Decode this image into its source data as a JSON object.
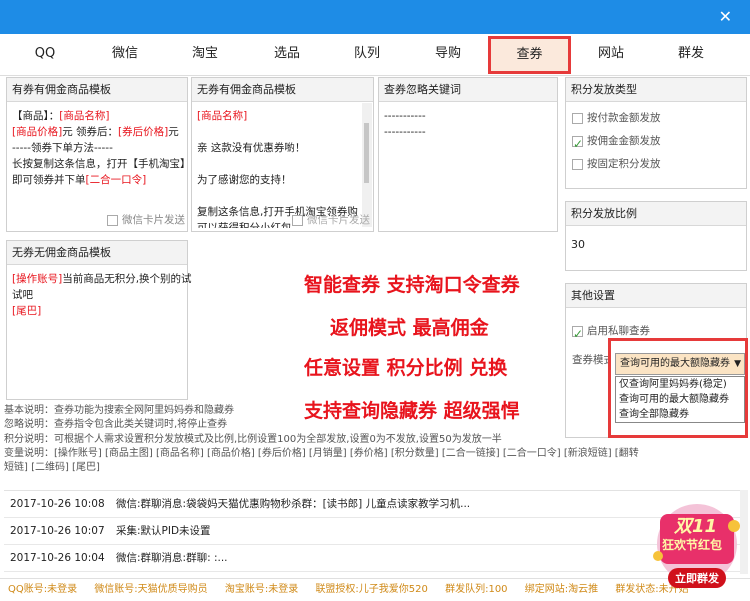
{
  "tabs": [
    "QQ",
    "微信",
    "淘宝",
    "选品",
    "队列",
    "导购",
    "查券",
    "网站",
    "群发"
  ],
  "close_glyph": "✕",
  "panels": {
    "coupon_tpl": {
      "title": "有券有佣金商品模板",
      "lines": [
        [
          "【商品】：",
          "[商品名称]"
        ],
        [
          "[商品价格]",
          "元 领券后：",
          "[券后价格]",
          "元"
        ],
        [
          "-----领券下单方法-----"
        ],
        [
          "长按复制这条信息，打开【手机淘宝】"
        ],
        [
          "即可领券并下单",
          "[二合一口令]"
        ]
      ],
      "wechat_card": "微信卡片发送"
    },
    "no_coupon_tpl": {
      "title": "无券有佣金商品模板",
      "lines": [
        "[商品名称]",
        "",
        "亲 这款没有优惠券喲！",
        "",
        "为了感谢您的支持！",
        "",
        "复制这条信息,打开手机淘宝领券购买",
        "可以获得积分小红包"
      ],
      "wechat_card": "微信卡片发送"
    },
    "keywords": {
      "title": "查券忽略关键词",
      "lines": [
        "-----------",
        "-----------"
      ]
    },
    "no_commission_tpl": {
      "title": "无券无佣金商品模板",
      "lines": [
        [
          "[操作账号]",
          "当前商品无积分,换个别的试"
        ],
        [
          "试吧"
        ],
        [
          "[尾巴]"
        ]
      ]
    },
    "points_type": {
      "title": "积分发放类型",
      "options": [
        {
          "label": "按付款金额发放",
          "checked": false
        },
        {
          "label": "按佣金金额发放",
          "checked": true
        },
        {
          "label": "按固定积分发放",
          "checked": false
        }
      ]
    },
    "points_ratio": {
      "title": "积分发放比例",
      "value": "30"
    },
    "other": {
      "title": "其他设置",
      "private_query": {
        "label": "启用私聊查券",
        "checked": true
      },
      "mode_label": "查券模式"
    }
  },
  "dropdown": {
    "selected": "查询可用的最大额隐藏券",
    "options": [
      "仅查询阿里妈妈券(稳定)",
      "查询可用的最大额隐藏券",
      "查询全部隐藏券"
    ]
  },
  "promo": [
    "智能查券  支持淘口令查券",
    "返佣模式  最高佣金",
    "任意设置  积分比例    兑换",
    "支持查询隐藏券  超级强悍"
  ],
  "help": [
    "基本说明：查券功能为搜索全网阿里妈妈券和隐藏券",
    "忽略说明：查券指令包含此类关键词时,将停止查券",
    "积分说明：可根据个人需求设置积分发放模式及比例,比例设置100为全部发放,设置0为不发放,设置50为发放一半",
    "变量说明：[操作账号]    [商品主图]    [商品名称]    [商品价格]    [券后价格]    [月销量]    [券价格]    [积分数量]    [二合一链接]    [二合一口令]    [新浪短链]    [翻转",
    "短链]    [二维码]    [尾巴]"
  ],
  "log": [
    {
      "time": "2017-10-26 10:08",
      "msg": "微信:群聊消息:袋袋妈天猫优惠购物秒杀群：[读书郎] 儿童点读家教学习机..."
    },
    {
      "time": "2017-10-26 10:07",
      "msg": "采集:默认PID未设置"
    },
    {
      "time": "2017-10-26 10:04",
      "msg": "微信:群聊消息:群聊: :..."
    }
  ],
  "status": [
    "QQ账号:未登录",
    "微信账号:天猫优质导购员",
    "淘宝账号:未登录",
    "联盟授权:儿子我爱你520",
    "群发队列:100",
    "绑定网站:淘云推",
    "群发状态:未开始"
  ],
  "badge": {
    "line1": "双11",
    "line2": "狂欢节红包",
    "button": "立即群发"
  },
  "colors": {
    "accent": "#1e8ce6",
    "highlight": "#e63a3a",
    "promo": "#e8141d",
    "status": "#d08a18"
  }
}
